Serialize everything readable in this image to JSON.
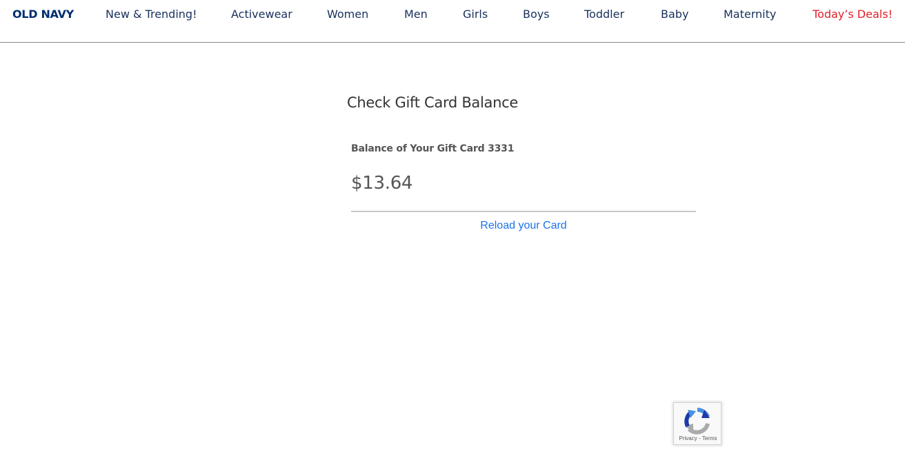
{
  "brand": {
    "logo_text": "OLD NAVY"
  },
  "nav": {
    "items": [
      {
        "label": "New & Trending!"
      },
      {
        "label": "Activewear"
      },
      {
        "label": "Women"
      },
      {
        "label": "Men"
      },
      {
        "label": "Girls"
      },
      {
        "label": "Boys"
      },
      {
        "label": "Toddler"
      },
      {
        "label": "Baby"
      },
      {
        "label": "Maternity"
      },
      {
        "label": "Today’s Deals!"
      }
    ]
  },
  "main": {
    "title": "Check Gift Card Balance",
    "balance_label": "Balance of Your Gift Card 3331",
    "balance_amount": "$13.64",
    "reload_link": "Reload your Card"
  },
  "recaptcha": {
    "privacy": "Privacy",
    "separator": " - ",
    "terms": "Terms"
  },
  "colors": {
    "brand_navy": "#002d72",
    "nav_text": "#18305c",
    "deals_red": "#e41e26",
    "link_blue": "#1a73e8"
  }
}
